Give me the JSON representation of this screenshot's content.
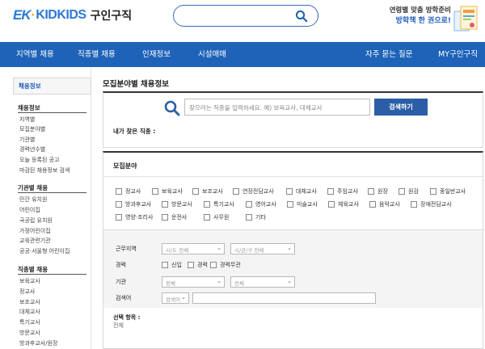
{
  "header": {
    "logo_mark_a": "EK",
    "logo_mark_b": "·",
    "logo_brand": "KIDKIDS",
    "logo_sub": "구인구직",
    "promo_line1": "연령별 맞춤 방학준비",
    "promo_line2": "방학책 한 권으로!"
  },
  "nav": {
    "items": [
      "지역별 채용",
      "직종별 채용",
      "인재정보",
      "시설매매",
      "자주 묻는 질문",
      "MY구인구직"
    ]
  },
  "sidebar": {
    "active": "채용정보",
    "section1_title": "채용정보",
    "section1_items": [
      "지역별",
      "모집분야별",
      "기관별",
      "경력년수별",
      "오늘 등록된 공고",
      "마감된 채용정보 검색"
    ],
    "section2_title": "기관별 채용",
    "section2_items": [
      "민간 유치원",
      "어린이집",
      "국공립 유치원",
      "가정어린이집",
      "교육관련기관",
      "공공·서울형 어린이집"
    ],
    "section3_title": "직종별 채용",
    "section3_items": [
      "보육교사",
      "정교사",
      "보조교사",
      "대체교사",
      "특기교사",
      "방문교사",
      "방과후교사/원장"
    ]
  },
  "main": {
    "title": "모집분야별 채용정보",
    "search_placeholder": "찾으려는 직종을 입력하세요. 예) 보육교사, 대체교사",
    "search_button": "검색하기",
    "found_label": "내가 찾은 직종 :",
    "category_title": "모집분야",
    "categories_row1": [
      "정교사",
      "보육교사",
      "보조교사",
      "연장전담교사",
      "대체교사",
      "주임교사",
      "원장",
      "원감",
      "종일반교사"
    ],
    "categories_row2": [
      "방과후교사",
      "방문교사",
      "특기교사",
      "영어교사",
      "미술교사",
      "체육교사",
      "음악교사",
      "장애전담교사"
    ],
    "categories_row3": [
      "영양·조리사",
      "운전사",
      "사무원",
      "기타"
    ],
    "filters": {
      "region_label": "근무지역",
      "region_sel1": "시/도 전체",
      "region_sel2": "시/군/구 전체",
      "career_label": "경력",
      "career_opts": [
        "신입",
        "경력",
        "경력무관"
      ],
      "org_label": "기관",
      "org_sel1": "전체",
      "org_sel2": "전체",
      "kw_label": "검색어",
      "kw_sel": "검색어"
    },
    "selected_label": "선택 항목 :",
    "selected_value": "전체"
  },
  "colors": {
    "brand_blue": "#1e63b8",
    "button_blue": "#2c5ea8",
    "logo_orange": "#f1a51c"
  },
  "icons": {
    "search": "magnifier-icon",
    "chevron": "chevron-right-icon",
    "dropdown": "chevron-down-icon"
  }
}
